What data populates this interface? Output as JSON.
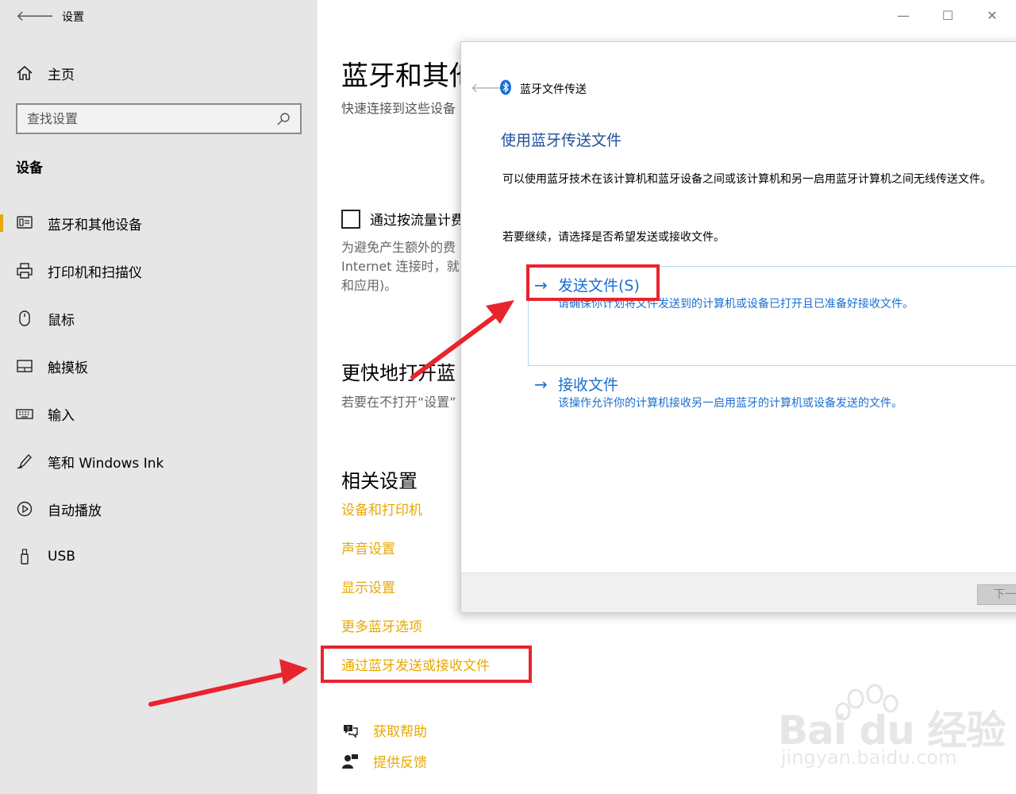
{
  "window": {
    "title": "设置",
    "controls": {
      "minimize": "—",
      "maximize": "☐",
      "close": "✕"
    }
  },
  "sidebar": {
    "home_label": "主页",
    "search_placeholder": "查找设置",
    "section_heading": "设备",
    "items": [
      {
        "label": "蓝牙和其他设备",
        "icon": "bluetooth-devices-icon",
        "selected": true
      },
      {
        "label": "打印机和扫描仪",
        "icon": "printer-icon",
        "selected": false
      },
      {
        "label": "鼠标",
        "icon": "mouse-icon",
        "selected": false
      },
      {
        "label": "触摸板",
        "icon": "touchpad-icon",
        "selected": false
      },
      {
        "label": "输入",
        "icon": "keyboard-icon",
        "selected": false
      },
      {
        "label": "笔和 Windows Ink",
        "icon": "pen-icon",
        "selected": false
      },
      {
        "label": "自动播放",
        "icon": "autoplay-icon",
        "selected": false
      },
      {
        "label": "USB",
        "icon": "usb-icon",
        "selected": false
      }
    ],
    "accent_color": "#e8a800"
  },
  "main": {
    "title": "蓝牙和其他",
    "subtitle": "快速连接到这些设备",
    "metered_checkbox_label": "通过按流量计费",
    "metered_desc_lines": [
      "为避免产生额外的费",
      "Internet 连接时，就",
      "和应用)。"
    ],
    "faster_heading": "更快地打开蓝",
    "faster_desc": "若要在不打开“设置”",
    "related_heading": "相关设置",
    "related_links": [
      "设备和打印机",
      "声音设置",
      "显示设置",
      "更多蓝牙选项",
      "通过蓝牙发送或接收文件"
    ],
    "help_links": [
      {
        "label": "获取帮助",
        "icon": "help-chat-icon"
      },
      {
        "label": "提供反馈",
        "icon": "feedback-icon"
      }
    ]
  },
  "dialog": {
    "window_title": "蓝牙文件传送",
    "heading": "使用蓝牙传送文件",
    "description": "可以使用蓝牙技术在该计算机和蓝牙设备之间或该计算机和另一启用蓝牙计算机之间无线传送文件。",
    "prompt": "若要继续，请选择是否希望发送或接收文件。",
    "options": [
      {
        "title": "发送文件(S)",
        "desc": "请确保你计划将文件发送到的计算机或设备已打开且已准备好接收文件。"
      },
      {
        "title": "接收文件",
        "desc": "该操作允许你的计算机接收另一启用蓝牙的计算机或设备发送的文件。"
      }
    ],
    "next_button": "下一",
    "link_color": "#1a6fd1"
  },
  "watermark": {
    "brand": "Bai du 经验",
    "url": "jingyan.baidu.com"
  },
  "annotation_color": "#e8242d"
}
